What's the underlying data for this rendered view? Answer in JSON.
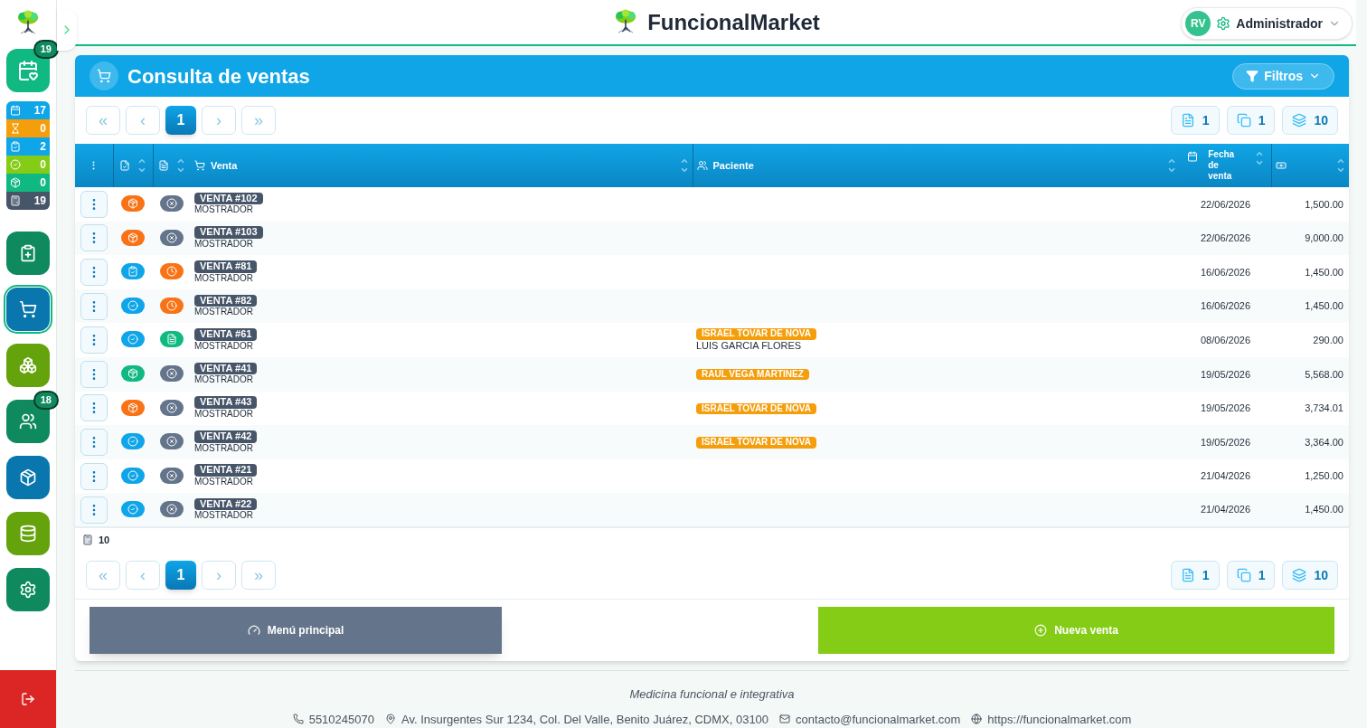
{
  "brand": {
    "name": "FuncionalMarket"
  },
  "user": {
    "initials": "RV",
    "role": "Administrador"
  },
  "sidebar": {
    "top_button": {
      "color": "#10b981",
      "badge": "19",
      "selected": false
    },
    "counters": [
      {
        "value": "17",
        "color": "#0ea5e9"
      },
      {
        "value": "0",
        "color": "#f59e0b"
      },
      {
        "value": "2",
        "color": "#0ea5e9"
      },
      {
        "value": "0",
        "color": "#84cc16"
      },
      {
        "value": "0",
        "color": "#10b981"
      },
      {
        "value": "19",
        "color": "#475569"
      }
    ],
    "nav": [
      {
        "color": "#0f8a5f",
        "selected": false
      },
      {
        "color": "#0a76ae",
        "selected": true
      },
      {
        "color": "#65a30d",
        "selected": false
      },
      {
        "color": "#0f8a5f",
        "selected": false,
        "badge": "18"
      },
      {
        "color": "#0a76ae",
        "selected": false
      },
      {
        "color": "#65a30d",
        "selected": false
      },
      {
        "color": "#0f8a5f",
        "selected": false
      }
    ]
  },
  "panel": {
    "title": "Consulta de ventas",
    "filter_button": "Filtros"
  },
  "pagination_top": {
    "first": "«",
    "prev": "‹",
    "pages": [
      {
        "label": "1",
        "selected": true
      }
    ],
    "next": "›",
    "last": "»",
    "stats": [
      "1",
      "1",
      "10"
    ]
  },
  "table": {
    "columns": [
      {
        "label": "⋮",
        "kind": "menu"
      },
      {
        "kind": "status"
      },
      {
        "kind": "doc"
      },
      {
        "label": "Venta",
        "kind": "sale"
      },
      {
        "label": "Paciente",
        "kind": "patient"
      },
      {
        "label": "Fecha de venta",
        "kind": "date"
      },
      {
        "kind": "amount"
      }
    ],
    "rows": [
      {
        "status": {
          "kind": "box"
        },
        "document": {
          "kind": "cancel"
        },
        "sale": "VENTA #102",
        "origin": "MOSTRADOR",
        "date": "22/06/2026",
        "amount": "1,500.00"
      },
      {
        "status": {
          "kind": "box"
        },
        "document": {
          "kind": "cancel"
        },
        "sale": "VENTA #103",
        "origin": "MOSTRADOR",
        "date": "22/06/2026",
        "amount": "9,000.00"
      },
      {
        "status": {
          "kind": "clipboard"
        },
        "document": {
          "kind": "clock"
        },
        "sale": "VENTA #81",
        "origin": "MOSTRADOR",
        "date": "16/06/2026",
        "amount": "1,450.00"
      },
      {
        "status": {
          "kind": "check"
        },
        "document": {
          "kind": "clock"
        },
        "sale": "VENTA #82",
        "origin": "MOSTRADOR",
        "date": "16/06/2026",
        "amount": "1,450.00"
      },
      {
        "status": {
          "kind": "check"
        },
        "document": {
          "kind": "file"
        },
        "sale": "VENTA #61",
        "origin": "MOSTRADOR",
        "patient_tag": "ISRAEL TOVAR DE NOVA",
        "patient_name": "LUIS GARCIA FLORES",
        "date": "08/06/2026",
        "amount": "290.00"
      },
      {
        "status": {
          "kind": "delivered"
        },
        "document": {
          "kind": "cancel"
        },
        "sale": "VENTA #41",
        "origin": "MOSTRADOR",
        "patient_tag": "RAUL VEGA MARTINEZ",
        "date": "19/05/2026",
        "amount": "5,568.00"
      },
      {
        "status": {
          "kind": "box"
        },
        "document": {
          "kind": "cancel"
        },
        "sale": "VENTA #43",
        "origin": "MOSTRADOR",
        "patient_tag": "ISRAEL TOVAR DE NOVA",
        "date": "19/05/2026",
        "amount": "3,734.01"
      },
      {
        "status": {
          "kind": "check"
        },
        "document": {
          "kind": "cancel"
        },
        "sale": "VENTA #42",
        "origin": "MOSTRADOR",
        "patient_tag": "ISRAEL TOVAR DE NOVA",
        "date": "19/05/2026",
        "amount": "3,364.00"
      },
      {
        "status": {
          "kind": "check"
        },
        "document": {
          "kind": "cancel"
        },
        "sale": "VENTA #21",
        "origin": "MOSTRADOR",
        "date": "21/04/2026",
        "amount": "1,250.00"
      },
      {
        "status": {
          "kind": "check"
        },
        "document": {
          "kind": "cancel"
        },
        "sale": "VENTA #22",
        "origin": "MOSTRADOR",
        "date": "21/04/2026",
        "amount": "1,450.00"
      }
    ],
    "total": "10"
  },
  "pagination_bottom": {
    "first": "«",
    "prev": "‹",
    "pages": [
      {
        "label": "1",
        "selected": true
      }
    ],
    "next": "›",
    "last": "»",
    "stats": [
      "1",
      "1",
      "10"
    ]
  },
  "actions": [
    {
      "label": "Menú principal",
      "kind": "secondary"
    },
    {
      "label": "Nueva venta",
      "kind": "primary"
    }
  ],
  "footer": {
    "tagline": "Medicina funcional e integrativa",
    "contacts": [
      "5510245070",
      "Av. Insurgentes Sur 1234, Col. Del Valle, Benito Juárez, CDMX, 03100",
      "contacto@funcionalmarket.com",
      "https://funcionalmarket.com"
    ]
  }
}
